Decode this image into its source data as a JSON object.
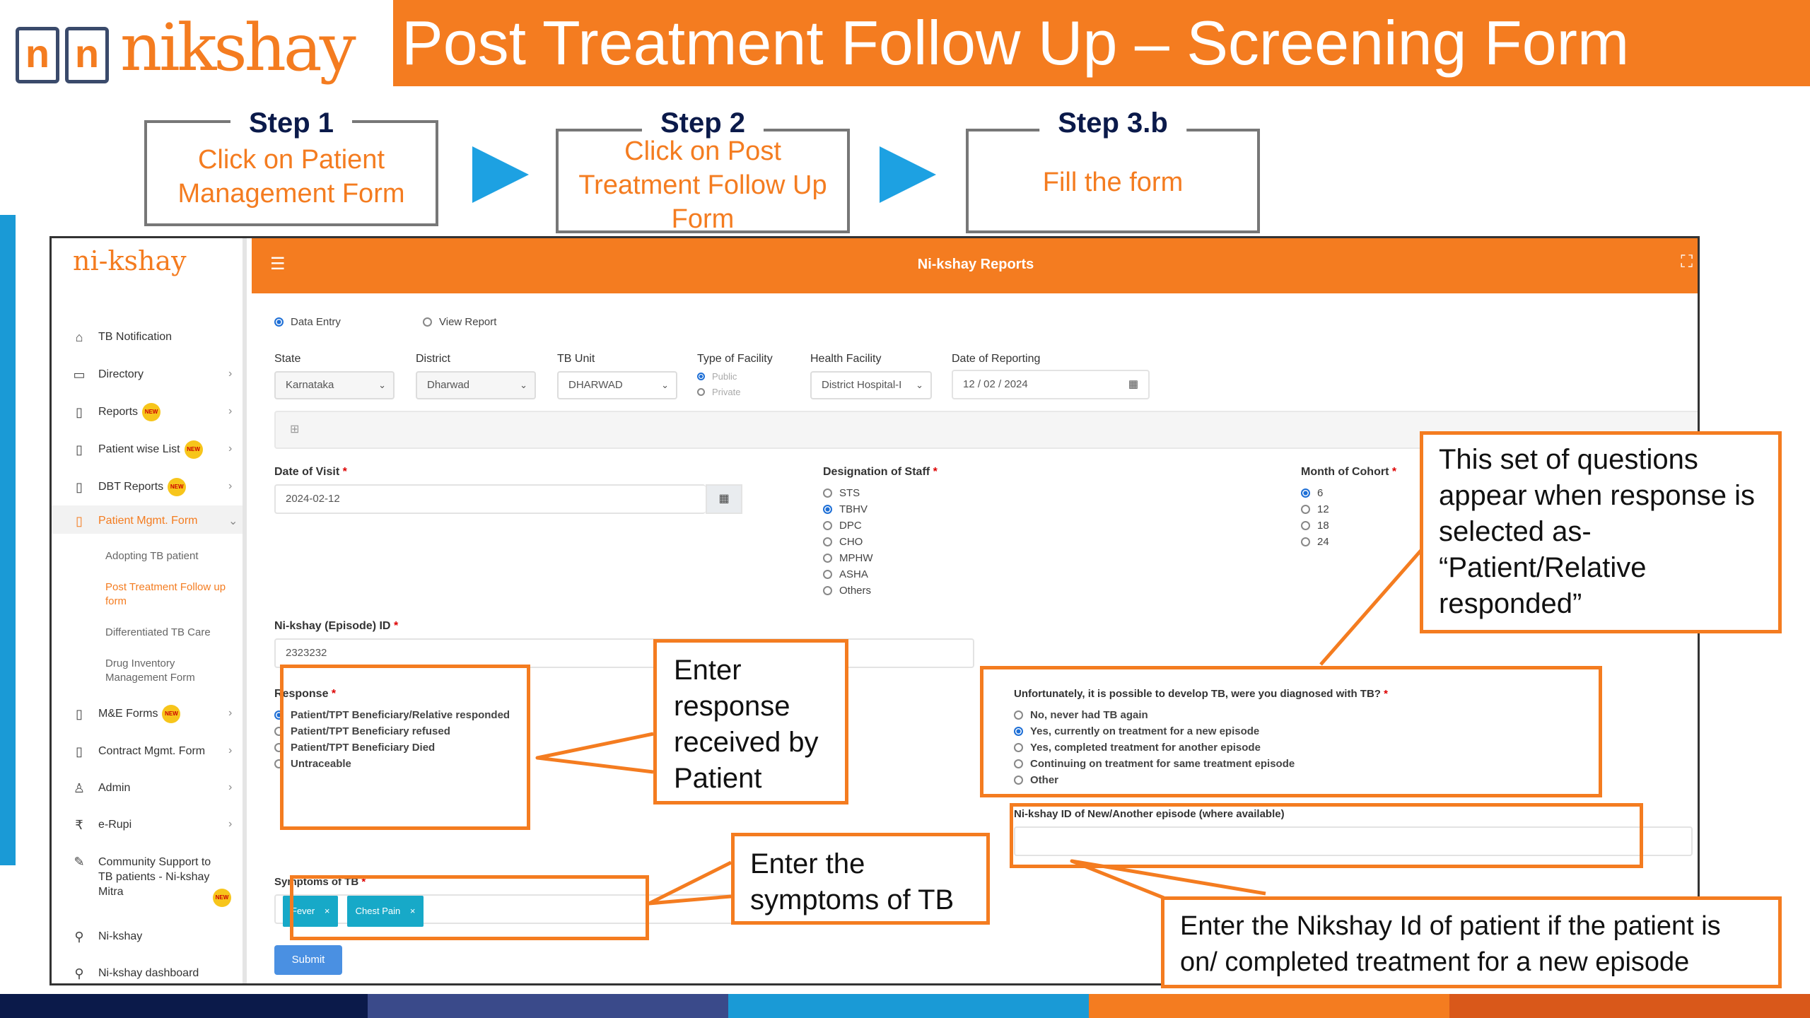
{
  "header": {
    "logo_text": "nikshay",
    "logo_box_letter": "n",
    "title": "Post Treatment Follow Up – Screening Form"
  },
  "steps": [
    {
      "label": "Step 1",
      "text": "Click on Patient Management Form"
    },
    {
      "label": "Step 2",
      "text": "Click on Post Treatment Follow Up Form"
    },
    {
      "label": "Step 3.b",
      "text": "Fill the form"
    }
  ],
  "app": {
    "logo_text": "ni-kshay",
    "topbar_title": "Ni-kshay Reports",
    "menu_icon": "☰",
    "fullscreen_icon": "⛶",
    "new_badge": "NEW",
    "sidebar": [
      {
        "label": "TB Notification",
        "icon": "home-icon"
      },
      {
        "label": "Directory",
        "icon": "folder-icon"
      },
      {
        "label": "Reports",
        "icon": "report-icon",
        "badge": true
      },
      {
        "label": "Patient wise List",
        "icon": "report-icon",
        "badge": true
      },
      {
        "label": "DBT Reports",
        "icon": "report-icon",
        "badge": true
      },
      {
        "label": "Patient Mgmt. Form",
        "icon": "form-icon",
        "active": true
      },
      {
        "label": "M&E Forms",
        "icon": "form-icon",
        "badge": true
      },
      {
        "label": "Contract Mgmt. Form",
        "icon": "form-icon"
      },
      {
        "label": "Admin",
        "icon": "user-icon"
      },
      {
        "label": "e-Rupi",
        "icon": "rupee-icon"
      },
      {
        "label": "Community Support to TB patients - Ni-kshay Mitra",
        "icon": "edit-icon",
        "badge": true
      },
      {
        "label": "Ni-kshay",
        "icon": "link-icon"
      },
      {
        "label": "Ni-kshay dashboard",
        "icon": "link-icon"
      }
    ],
    "submenu": [
      "Adopting TB patient",
      "Post Treatment Follow up form",
      "Differentiated TB Care",
      "Drug Inventory Management Form"
    ]
  },
  "form": {
    "mode": {
      "data_entry": "Data Entry",
      "view_report": "View Report"
    },
    "filters": {
      "state_label": "State",
      "state_value": "Karnataka",
      "district_label": "District",
      "district_value": "Dharwad",
      "tbu_label": "TB Unit",
      "tbu_value": "DHARWAD",
      "facility_type_label": "Type of Facility",
      "facility_public": "Public",
      "facility_private": "Private",
      "health_facility_label": "Health Facility",
      "health_facility_value": "District Hospital-I",
      "reporting_date_label": "Date of Reporting",
      "reporting_date_value": "12 / 02 / 2024"
    },
    "date_of_visit_label": "Date of Visit",
    "date_of_visit_value": "2024-02-12",
    "designation_label": "Designation of Staff",
    "designations": [
      "STS",
      "TBHV",
      "DPC",
      "CHO",
      "MPHW",
      "ASHA",
      "Others"
    ],
    "designation_selected": "TBHV",
    "cohort_label": "Month of Cohort",
    "cohorts": [
      "6",
      "12",
      "18",
      "24"
    ],
    "cohort_selected": "6",
    "episode_id_label": "Ni-kshay (Episode) ID",
    "episode_id_value": "2323232",
    "response_label": "Response",
    "responses": [
      "Patient/TPT Beneficiary/Relative responded",
      "Patient/TPT Beneficiary refused",
      "Patient/TPT Beneficiary Died",
      "Untraceable"
    ],
    "tb_question": "Unfortunately, it is possible to develop TB, were you diagnosed with TB?",
    "tb_options": [
      "No, never had TB again",
      "Yes, currently on treatment for a new episode",
      "Yes, completed treatment for another episode",
      "Continuing on treatment for same treatment episode",
      "Other"
    ],
    "new_episode_label": "Ni-kshay ID of New/Another episode (where available)",
    "symptoms_label": "Symptoms of TB",
    "symptoms": [
      "Fever",
      "Chest Pain"
    ],
    "submit": "Submit"
  },
  "callouts": {
    "questions": "This set of questions appear when response is selected as- “Patient/Relative responded”",
    "response": "Enter response received by Patient",
    "symptoms": "Enter the symptoms of TB",
    "nikshay_id": "Enter the Nikshay Id of patient if the patient is on/ completed treatment for a new episode"
  },
  "colors": {
    "orange": "#f47c20",
    "navy": "#0b1a4a",
    "blue": "#1da1e2"
  }
}
